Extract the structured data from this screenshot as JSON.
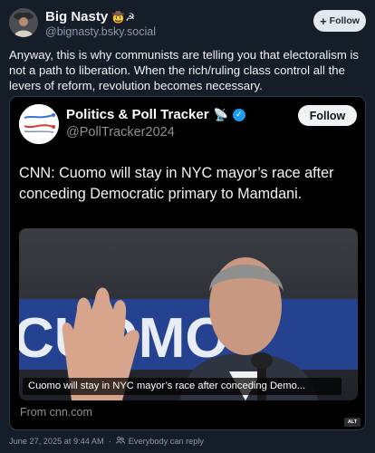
{
  "author": {
    "name": "Big Nasty",
    "emoji": "🤠☭",
    "handle": "@bignasty.bsky.social",
    "follow_label": "Follow"
  },
  "post": {
    "text": "Anyway, this is why communists are telling you that electoralism is not a path to liberation. When the rich/ruling class control all the levers of reform, revolution becomes necessary."
  },
  "embed": {
    "name": "Politics & Poll Tracker",
    "emoji": "📡",
    "handle": "@PollTracker2024",
    "follow_label": "Follow",
    "text": "CNN: Cuomo will stay in NYC mayor’s race after conceding Democratic primary to Mamdani.",
    "caption": "Cuomo will stay in NYC mayor’s race after conceding Demo...",
    "source": "From cnn.com",
    "alt_badge": "ALT",
    "sign_text": "CUOMO"
  },
  "footer": {
    "date": "June 27, 2025 at 9:44 AM",
    "separator": "·",
    "reply_setting": "Everybody can reply"
  },
  "colors": {
    "background": "#151d28",
    "verified": "#1d9bf0"
  }
}
